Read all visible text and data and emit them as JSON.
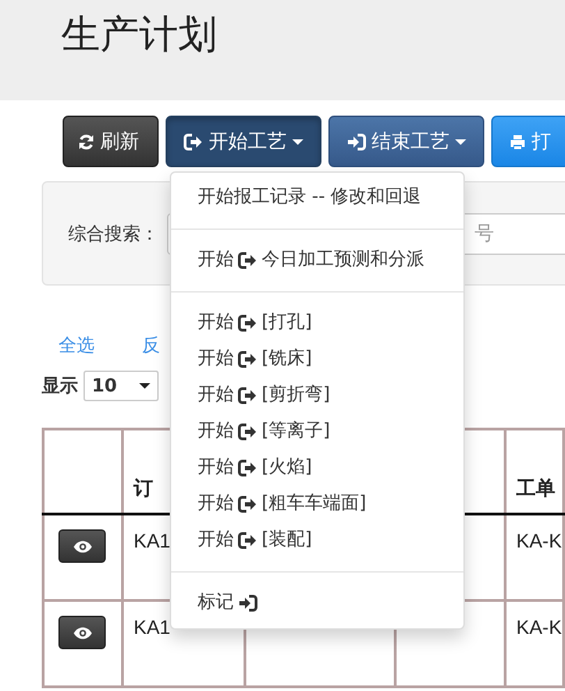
{
  "page_title": "生产计划",
  "toolbar": [
    {
      "label": "刷新",
      "caret": false,
      "expanded": false
    },
    {
      "label": "开始工艺",
      "caret": true,
      "expanded": true
    },
    {
      "label": "结束工艺",
      "caret": true,
      "expanded": false
    },
    {
      "label": "打",
      "caret": false,
      "expanded": false
    }
  ],
  "search": {
    "label": "综合搜索：",
    "placeholder": "号"
  },
  "links": [
    "全选",
    "反"
  ],
  "page_size": {
    "label": "显示",
    "value": "10"
  },
  "table": {
    "columns": [
      "",
      "订",
      "",
      "",
      "工单"
    ],
    "rows": [
      [
        "",
        "KA1",
        "",
        "",
        "KA-K"
      ],
      [
        "",
        "KA1",
        "",
        "",
        "KA-K"
      ]
    ]
  },
  "menu": [
    {
      "kind": "plain",
      "prefix": "开始报工记录 -- 修改和回退"
    },
    {
      "kind": "divider"
    },
    {
      "kind": "start",
      "prefix": "开始",
      "text": "今日加工预测和分派"
    },
    {
      "kind": "divider"
    },
    {
      "kind": "start",
      "prefix": "开始",
      "text": "[打孔]"
    },
    {
      "kind": "start",
      "prefix": "开始",
      "text": "[铣床]"
    },
    {
      "kind": "start",
      "prefix": "开始",
      "text": "[剪折弯]"
    },
    {
      "kind": "start",
      "prefix": "开始",
      "text": "[等离子]"
    },
    {
      "kind": "start",
      "prefix": "开始",
      "text": "[火焰]"
    },
    {
      "kind": "start",
      "prefix": "开始",
      "text": "[粗车车端面]"
    },
    {
      "kind": "start",
      "prefix": "开始",
      "text": "[装配]"
    },
    {
      "kind": "divider"
    },
    {
      "kind": "end",
      "prefix": "标记"
    }
  ]
}
